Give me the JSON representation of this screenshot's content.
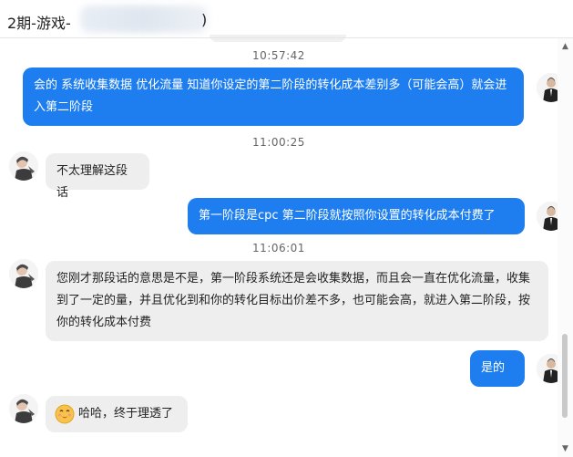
{
  "header": {
    "title": "2期-游戏-",
    "title_tail": ")"
  },
  "messages": [
    {
      "type": "timestamp",
      "text": "10:57:42"
    },
    {
      "type": "out",
      "text": "会的  系统收集数据 优化流量  知道你设定的第二阶段的转化成本差别多（可能会高）就会进入第二阶段"
    },
    {
      "type": "timestamp",
      "text": "11:00:25"
    },
    {
      "type": "in",
      "text": "不太理解这段话"
    },
    {
      "type": "out",
      "text": "第一阶段是cpc  第二阶段就按照你设置的转化成本付费了"
    },
    {
      "type": "timestamp",
      "text": "11:06:01"
    },
    {
      "type": "in",
      "text": "您刚才那段话的意思是不是，第一阶段系统还是会收集数据，而且会一直在优化流量，收集到了一定的量，并且优化到和你的转化目标出价差不多，也可能会高，就进入第二阶段，按你的转化成本付费"
    },
    {
      "type": "out",
      "text": "是的~"
    },
    {
      "type": "in",
      "text": "哈哈，终于理透了",
      "emoji": "smile-emoji"
    }
  ],
  "scrollbar": {
    "up": "▲",
    "down": "▼"
  },
  "colors": {
    "outgoing": "#1e7ef0",
    "incoming": "#eeeeee"
  }
}
